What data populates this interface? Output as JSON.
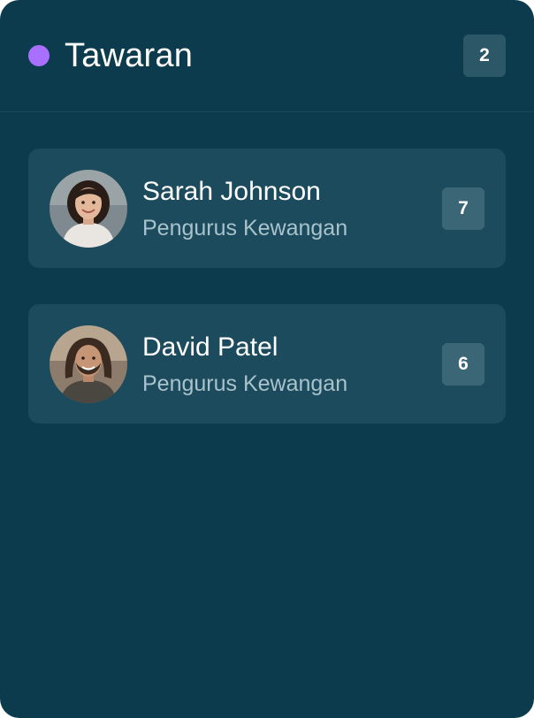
{
  "column": {
    "title": "Tawaran",
    "count": "2",
    "status_color": "#a970ff"
  },
  "cards": [
    {
      "name": "Sarah Johnson",
      "role": "Pengurus Kewangan",
      "count": "7",
      "avatar_icon": "person-avatar-female"
    },
    {
      "name": "David Patel",
      "role": "Pengurus Kewangan",
      "count": "6",
      "avatar_icon": "person-avatar-male"
    }
  ]
}
